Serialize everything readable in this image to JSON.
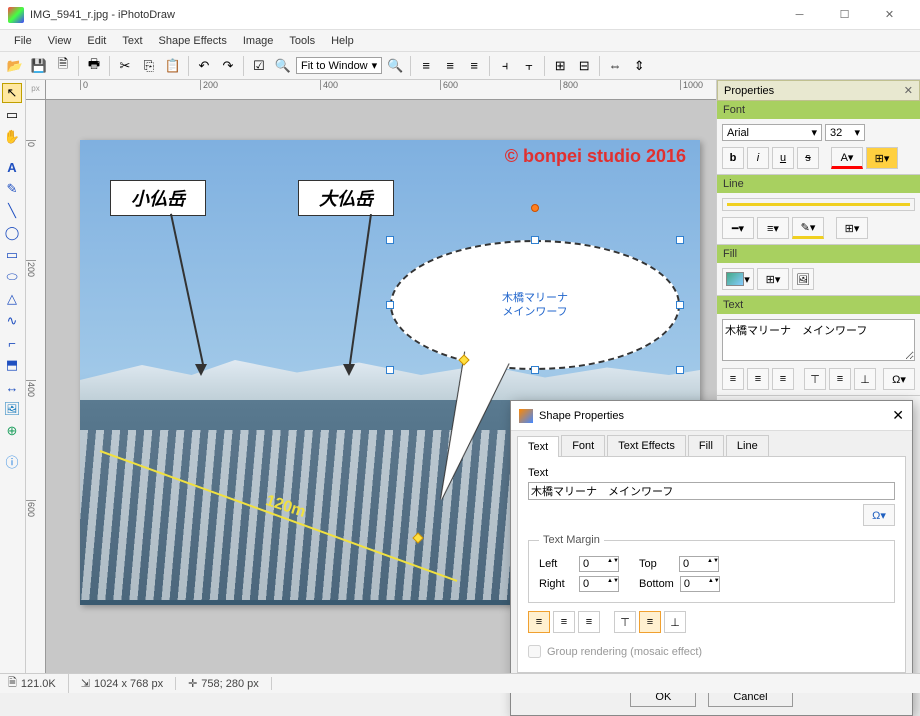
{
  "window": {
    "title": "IMG_5941_r.jpg - iPhotoDraw",
    "minimize": "─",
    "maximize": "☐",
    "close": "✕"
  },
  "menu": [
    "File",
    "View",
    "Edit",
    "Text",
    "Shape Effects",
    "Image",
    "Tools",
    "Help"
  ],
  "zoom_combo": "Fit to Window",
  "ruler_unit": "px",
  "ruler_h": [
    "0",
    "200",
    "400",
    "600",
    "800",
    "1000"
  ],
  "ruler_v": [
    "0",
    "200",
    "400",
    "600"
  ],
  "canvas": {
    "copyright": "© bonpei studio 2016",
    "label1": "小仏岳",
    "label2": "大仏岳",
    "callout": "木橋マリーナ\nメインワーフ",
    "dimension": "120m"
  },
  "properties": {
    "header": "Properties",
    "sections": {
      "font": {
        "title": "Font",
        "family": "Arial",
        "size": "32",
        "b": "b",
        "i": "i",
        "u": "u",
        "s": "s"
      },
      "line": {
        "title": "Line"
      },
      "fill": {
        "title": "Fill"
      },
      "text": {
        "title": "Text",
        "value": "木橋マリーナ　メインワーフ"
      }
    }
  },
  "dialog": {
    "title": "Shape Properties",
    "tabs": [
      "Text",
      "Font",
      "Text Effects",
      "Fill",
      "Line"
    ],
    "text_label": "Text",
    "text_value": "木橋マリーナ　メインワーフ",
    "margin_legend": "Text Margin",
    "margin": {
      "left_l": "Left",
      "left": "0",
      "right_l": "Right",
      "right": "0",
      "top_l": "Top",
      "top": "0",
      "bottom_l": "Bottom",
      "bottom": "0"
    },
    "group_rendering": "Group rendering (mosaic effect)",
    "ok": "OK",
    "cancel": "Cancel"
  },
  "status": {
    "filesize": "121.0K",
    "dimensions": "1024 x 768 px",
    "cursor": "758; 280 px"
  }
}
